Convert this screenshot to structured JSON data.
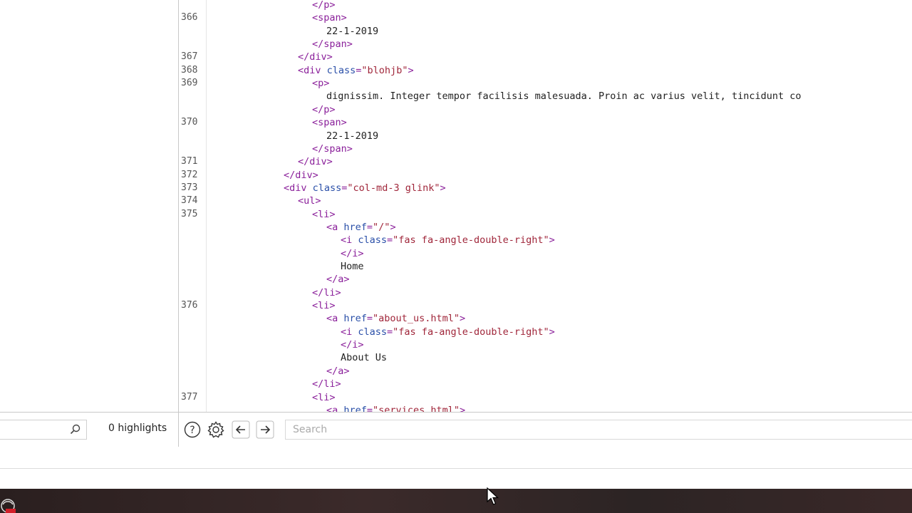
{
  "source_view": {
    "lines": [
      {
        "num": "",
        "indent": 9,
        "tokens": [
          {
            "t": "tag",
            "v": "</p>"
          }
        ]
      },
      {
        "num": "366",
        "indent": 9,
        "tokens": [
          {
            "t": "tag",
            "v": "<span>"
          }
        ]
      },
      {
        "num": "",
        "indent": 10,
        "tokens": [
          {
            "t": "text",
            "v": "22-1-2019"
          }
        ]
      },
      {
        "num": "",
        "indent": 9,
        "tokens": [
          {
            "t": "tag",
            "v": "</span>"
          }
        ]
      },
      {
        "num": "367",
        "indent": 8,
        "tokens": [
          {
            "t": "tag",
            "v": "</div>"
          }
        ]
      },
      {
        "num": "368",
        "indent": 8,
        "tokens": [
          {
            "t": "tag",
            "v": "<div "
          },
          {
            "t": "attr",
            "v": "class"
          },
          {
            "t": "tag",
            "v": "="
          },
          {
            "t": "val",
            "v": "\"blohjb\""
          },
          {
            "t": "tag",
            "v": ">"
          }
        ]
      },
      {
        "num": "369",
        "indent": 9,
        "tokens": [
          {
            "t": "tag",
            "v": "<p>"
          }
        ]
      },
      {
        "num": "",
        "indent": 10,
        "tokens": [
          {
            "t": "text",
            "v": "dignissim. Integer tempor facilisis malesuada. Proin ac varius velit, tincidunt co"
          }
        ]
      },
      {
        "num": "",
        "indent": 9,
        "tokens": [
          {
            "t": "tag",
            "v": "</p>"
          }
        ]
      },
      {
        "num": "370",
        "indent": 9,
        "tokens": [
          {
            "t": "tag",
            "v": "<span>"
          }
        ]
      },
      {
        "num": "",
        "indent": 10,
        "tokens": [
          {
            "t": "text",
            "v": "22-1-2019"
          }
        ]
      },
      {
        "num": "",
        "indent": 9,
        "tokens": [
          {
            "t": "tag",
            "v": "</span>"
          }
        ]
      },
      {
        "num": "371",
        "indent": 8,
        "tokens": [
          {
            "t": "tag",
            "v": "</div>"
          }
        ]
      },
      {
        "num": "372",
        "indent": 7,
        "tokens": [
          {
            "t": "tag",
            "v": "</div>"
          }
        ]
      },
      {
        "num": "373",
        "indent": 7,
        "tokens": [
          {
            "t": "tag",
            "v": "<div "
          },
          {
            "t": "attr",
            "v": "class"
          },
          {
            "t": "tag",
            "v": "="
          },
          {
            "t": "val",
            "v": "\"col-md-3 glink\""
          },
          {
            "t": "tag",
            "v": ">"
          }
        ]
      },
      {
        "num": "374",
        "indent": 8,
        "tokens": [
          {
            "t": "tag",
            "v": "<ul>"
          }
        ]
      },
      {
        "num": "375",
        "indent": 9,
        "tokens": [
          {
            "t": "tag",
            "v": "<li>"
          }
        ]
      },
      {
        "num": "",
        "indent": 10,
        "tokens": [
          {
            "t": "tag",
            "v": "<a "
          },
          {
            "t": "attr",
            "v": "href"
          },
          {
            "t": "tag",
            "v": "="
          },
          {
            "t": "val",
            "v": "\"/\""
          },
          {
            "t": "tag",
            "v": ">"
          }
        ]
      },
      {
        "num": "",
        "indent": 11,
        "tokens": [
          {
            "t": "tag",
            "v": "<i "
          },
          {
            "t": "attr",
            "v": "class"
          },
          {
            "t": "tag",
            "v": "="
          },
          {
            "t": "val",
            "v": "\"fas fa-angle-double-right\""
          },
          {
            "t": "tag",
            "v": ">"
          }
        ]
      },
      {
        "num": "",
        "indent": 11,
        "tokens": [
          {
            "t": "tag",
            "v": "</i>"
          }
        ]
      },
      {
        "num": "",
        "indent": 11,
        "tokens": [
          {
            "t": "text",
            "v": "Home"
          }
        ]
      },
      {
        "num": "",
        "indent": 10,
        "tokens": [
          {
            "t": "tag",
            "v": "</a>"
          }
        ]
      },
      {
        "num": "",
        "indent": 9,
        "tokens": [
          {
            "t": "tag",
            "v": "</li>"
          }
        ]
      },
      {
        "num": "376",
        "indent": 9,
        "tokens": [
          {
            "t": "tag",
            "v": "<li>"
          }
        ]
      },
      {
        "num": "",
        "indent": 10,
        "tokens": [
          {
            "t": "tag",
            "v": "<a "
          },
          {
            "t": "attr",
            "v": "href"
          },
          {
            "t": "tag",
            "v": "="
          },
          {
            "t": "val",
            "v": "\"about_us.html\""
          },
          {
            "t": "tag",
            "v": ">"
          }
        ]
      },
      {
        "num": "",
        "indent": 11,
        "tokens": [
          {
            "t": "tag",
            "v": "<i "
          },
          {
            "t": "attr",
            "v": "class"
          },
          {
            "t": "tag",
            "v": "="
          },
          {
            "t": "val",
            "v": "\"fas fa-angle-double-right\""
          },
          {
            "t": "tag",
            "v": ">"
          }
        ]
      },
      {
        "num": "",
        "indent": 11,
        "tokens": [
          {
            "t": "tag",
            "v": "</i>"
          }
        ]
      },
      {
        "num": "",
        "indent": 11,
        "tokens": [
          {
            "t": "text",
            "v": "About Us"
          }
        ]
      },
      {
        "num": "",
        "indent": 10,
        "tokens": [
          {
            "t": "tag",
            "v": "</a>"
          }
        ]
      },
      {
        "num": "",
        "indent": 9,
        "tokens": [
          {
            "t": "tag",
            "v": "</li>"
          }
        ]
      },
      {
        "num": "377",
        "indent": 9,
        "tokens": [
          {
            "t": "tag",
            "v": "<li>"
          }
        ]
      },
      {
        "num": "",
        "indent": 10,
        "tokens": [
          {
            "t": "tag",
            "v": "<a "
          },
          {
            "t": "attr",
            "v": "href"
          },
          {
            "t": "tag",
            "v": "="
          },
          {
            "t": "val",
            "v": "\"services.html\""
          },
          {
            "t": "tag",
            "v": ">"
          }
        ]
      }
    ]
  },
  "find_bar": {
    "highlights_label": "0 highlights",
    "search_placeholder": "Search",
    "icons": [
      "search-icon",
      "help-icon",
      "gear-icon",
      "arrow-left-icon",
      "arrow-right-icon"
    ]
  },
  "colors": {
    "tag": "#8a1f9a",
    "attr": "#2a4fa8",
    "value": "#a0263a"
  }
}
